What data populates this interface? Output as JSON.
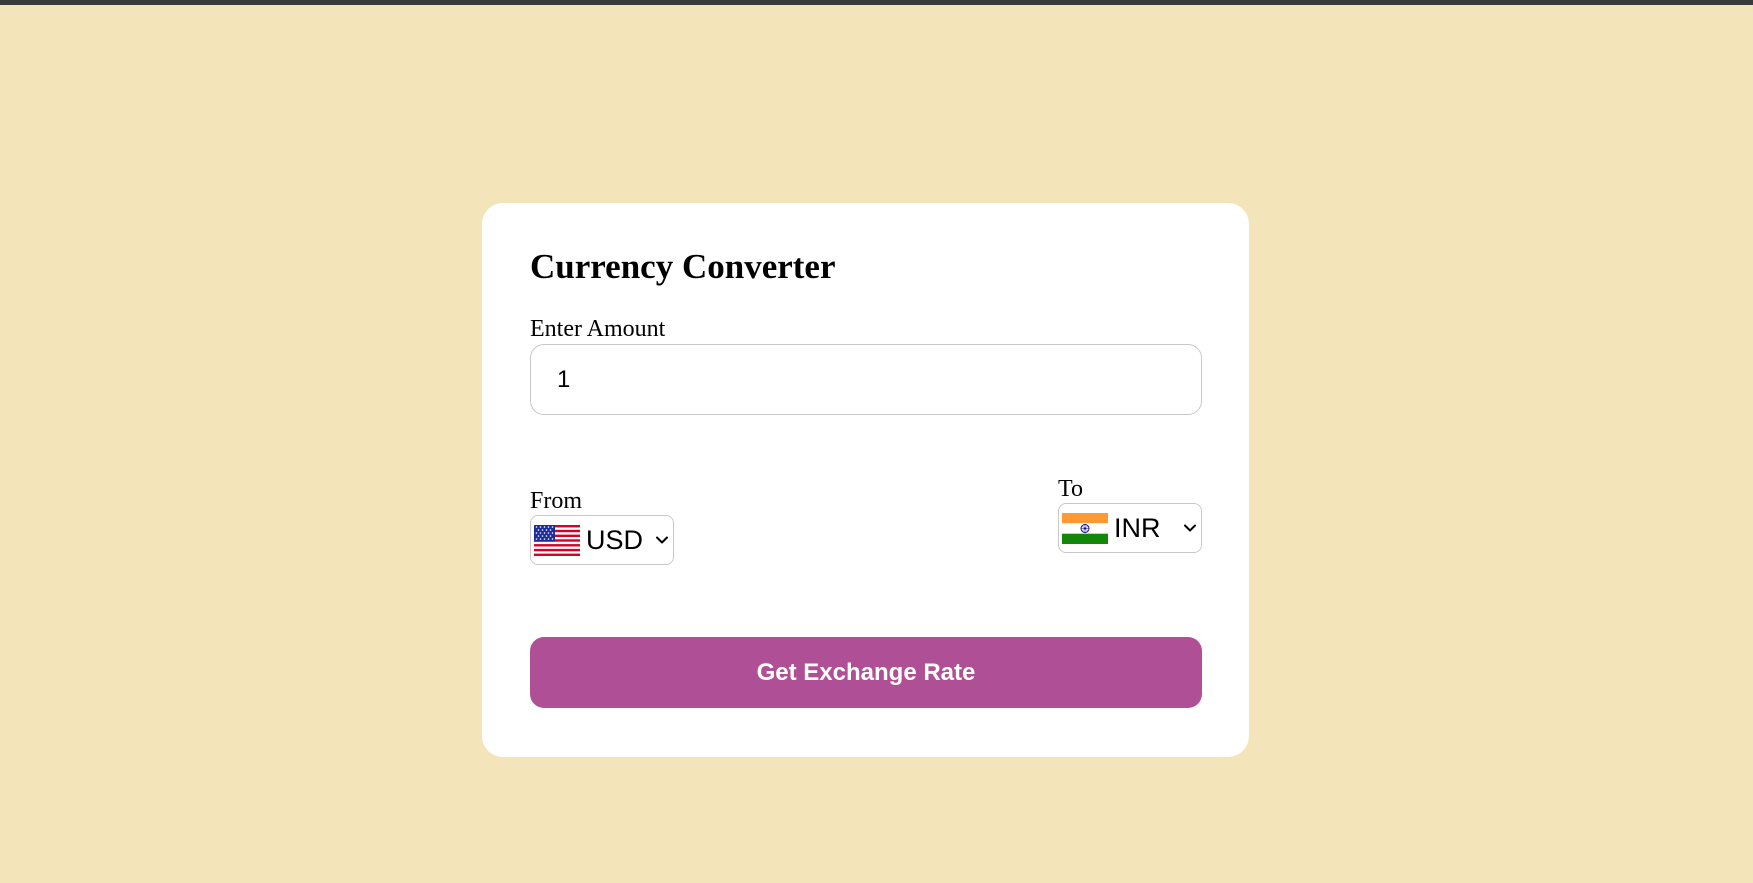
{
  "header": {
    "title": "Currency Converter"
  },
  "amount": {
    "label": "Enter Amount",
    "value": "1"
  },
  "from": {
    "label": "From",
    "currency": "USD",
    "flag_icon": "us-flag-icon"
  },
  "to": {
    "label": "To",
    "currency": "INR",
    "flag_icon": "india-flag-icon"
  },
  "actions": {
    "convert_label": "Get Exchange Rate"
  },
  "colors": {
    "page_background": "#f3e4b9",
    "card_background": "#ffffff",
    "button_background": "#af4f96",
    "button_text": "#ffffff"
  }
}
